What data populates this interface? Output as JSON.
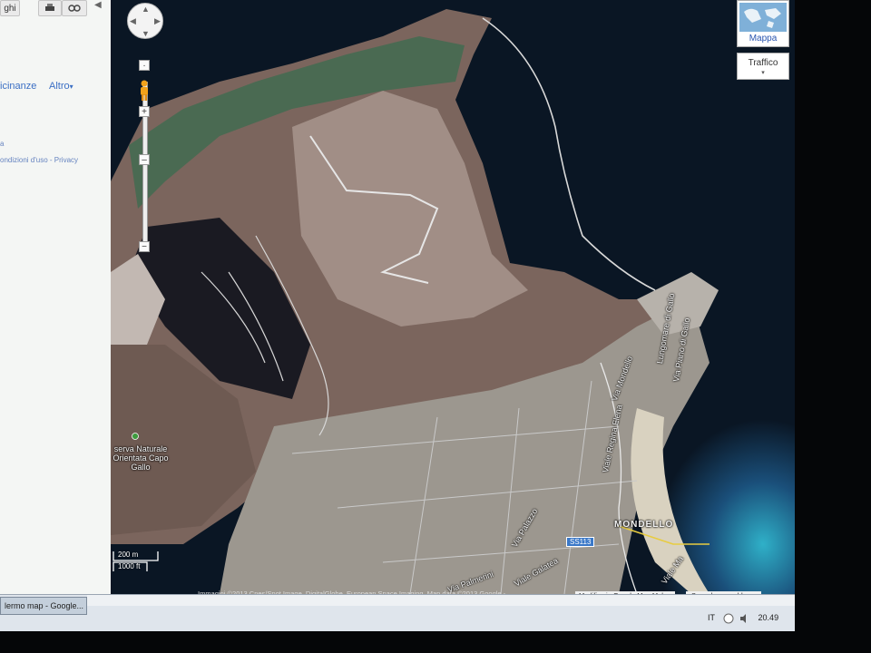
{
  "sidebar": {
    "button_1": "ghi",
    "print_icon": "printer-icon",
    "link_icon": "link-icon",
    "nearby": "icinanze",
    "more": "Altro",
    "more_arrow": "▾",
    "dot": "a",
    "footer": "ondizioni d'uso - Privacy",
    "collapse": "◀"
  },
  "map_controls": {
    "pan_up": "▲",
    "pan_down": "▼",
    "pan_left": "◀",
    "pan_right": "▶",
    "zoom_in": "+",
    "zoom_mid": "–",
    "zoom_out": "−",
    "map_type_label": "Mappa",
    "traffic_label": "Traffico",
    "traffic_arrow": "▾"
  },
  "map_labels": {
    "poi": "Riserva Naturale Orientata Capo Gallo",
    "poi_visible": "serva Naturale Orientata Capo Gallo",
    "town": "MONDELLO",
    "road_badge": "SS113",
    "street_1": "Via Mondello",
    "street_2": "Viale Regina Elena",
    "street_3": "Via Palazzo",
    "street_4": "Viale Galatea",
    "street_5": "Lungomare di Gallo",
    "street_6": "Via Piano di Gallo",
    "street_7": "Viale Ma",
    "street_8": "Via Palmerini"
  },
  "scale": {
    "metric": "200 m",
    "imperial": "1000 ft"
  },
  "attribution": "Immagini ©2013 Cnes/Spot Image, DigitalGlobe, European Space Imaging, Map data ©2013 Google -",
  "links": {
    "edit": "Modifica in Google Map Maker",
    "report": "Segnala un problema"
  },
  "taskbar": {
    "window": "lermo map - Google...",
    "lang": "IT",
    "time": "20.49"
  },
  "colors": {
    "sea_deep": "#0a1624",
    "sea_shallow": "#2fb0c8",
    "mountain": "#8a7168",
    "town": "#a7a2a0",
    "accent_link": "#3b6fc4"
  }
}
